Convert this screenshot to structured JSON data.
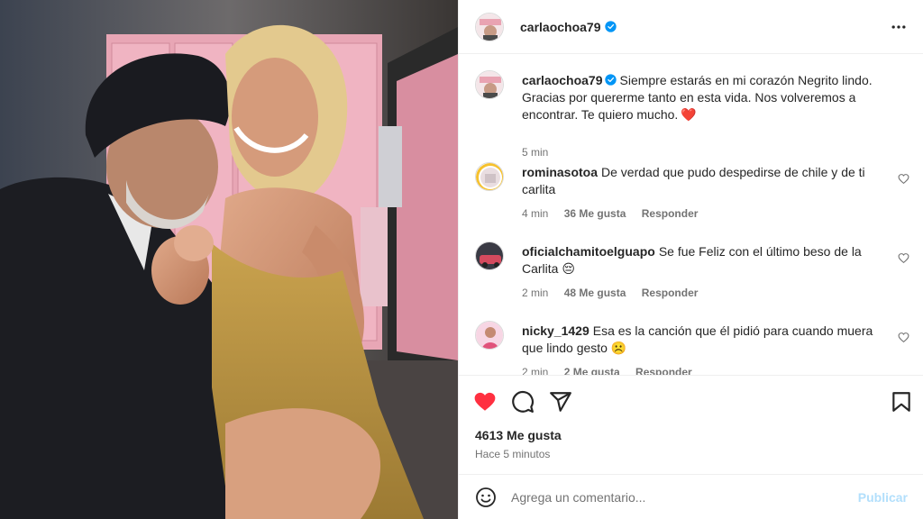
{
  "post": {
    "username": "carlaochoa79",
    "verified": true,
    "caption": {
      "author": "carlaochoa79",
      "text": "Siempre estarás en mi corazón Negrito lindo. Gracias por quererme tanto en esta vida. Nos volveremos a encontrar. Te quiero mucho.",
      "emoji": "❤️",
      "time": "5 min"
    },
    "likes": "4613 Me gusta",
    "time_ago": "Hace 5 minutos"
  },
  "comments": [
    {
      "author": "rominasotoa",
      "text": "De verdad que pudo despedirse de chile y de ti carlita",
      "time": "4 min",
      "likes": "36 Me gusta",
      "reply": "Responder"
    },
    {
      "author": "oficialchamitoelguapo",
      "text": "Se fue Feliz con el último beso de la Carlita",
      "emoji": "😔",
      "time": "2 min",
      "likes": "48 Me gusta",
      "reply": "Responder"
    },
    {
      "author": "nicky_1429",
      "text": "Esa es la canción que él pidió para cuando muera que lindo gesto",
      "emoji": "☹️",
      "time": "2 min",
      "likes": "2 Me gusta",
      "reply": "Responder"
    }
  ],
  "composer": {
    "placeholder": "Agrega un comentario...",
    "publish_label": "Publicar"
  },
  "icons": {
    "more": "more-horizontal-icon",
    "like": "heart-filled-icon",
    "comment": "comment-icon",
    "share": "send-icon",
    "save": "bookmark-icon",
    "emoji": "emoji-icon",
    "verified": "verified-badge-icon"
  },
  "colors": {
    "like_red": "#ff3040",
    "verified_blue": "#0095f6",
    "publish_disabled": "#b2dffc",
    "secondary_text": "#737373"
  }
}
